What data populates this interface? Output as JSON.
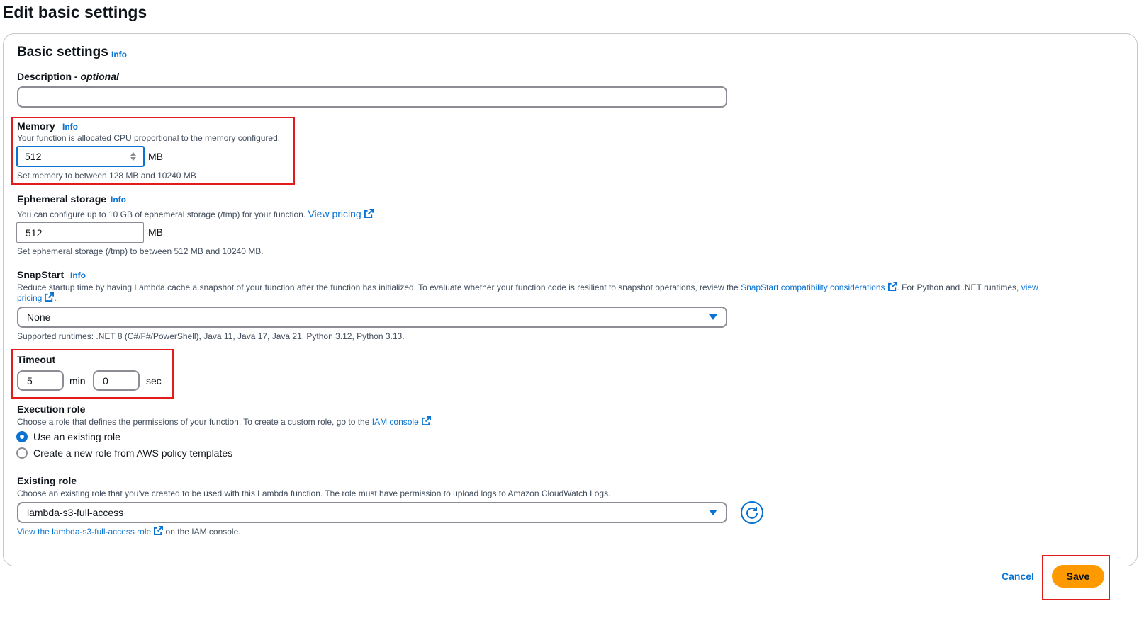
{
  "page": {
    "title": "Edit basic settings"
  },
  "section": {
    "title": "Basic settings",
    "info": "Info"
  },
  "description": {
    "label": "Description",
    "label_suffix": "optional",
    "value": ""
  },
  "memory": {
    "label": "Memory",
    "info": "Info",
    "desc": "Your function is allocated CPU proportional to the memory configured.",
    "value": "512",
    "unit": "MB",
    "hint": "Set memory to between 128 MB and 10240 MB"
  },
  "ephemeral": {
    "label": "Ephemeral storage",
    "info": "Info",
    "desc": "You can configure up to 10 GB of ephemeral storage (/tmp) for your function.",
    "link": "View pricing",
    "value": "512",
    "unit": "MB",
    "hint": "Set ephemeral storage (/tmp) to between 512 MB and 10240 MB."
  },
  "snapstart": {
    "label": "SnapStart",
    "info": "Info",
    "desc_1": "Reduce startup time by having Lambda cache a snapshot of your function after the function has initialized. To evaluate whether your function code is resilient to snapshot operations, review the",
    "link_1": "SnapStart compatibility considerations",
    "desc_2": ". For Python and .NET runtimes,",
    "link_2a": "view",
    "link_2b": "pricing",
    "desc_3": ".",
    "selected": "None",
    "hint": "Supported runtimes: .NET 8 (C#/F#/PowerShell), Java 11, Java 17, Java 21, Python 3.12, Python 3.13."
  },
  "timeout": {
    "label": "Timeout",
    "min_value": "5",
    "min_unit": "min",
    "sec_value": "0",
    "sec_unit": "sec"
  },
  "execution_role": {
    "label": "Execution role",
    "desc": "Choose a role that defines the permissions of your function. To create a custom role, go to the",
    "link": "IAM console",
    "desc_end": ".",
    "options": [
      "Use an existing role",
      "Create a new role from AWS policy templates"
    ],
    "selected_index": 0
  },
  "existing_role": {
    "label": "Existing role",
    "desc": "Choose an existing role that you've created to be used with this Lambda function. The role must have permission to upload logs to Amazon CloudWatch Logs.",
    "selected": "lambda-s3-full-access",
    "link": "View the lambda-s3-full-access role",
    "link_suffix": "on the IAM console."
  },
  "footer": {
    "cancel": "Cancel",
    "save": "Save"
  },
  "colors": {
    "accent": "#0972d3",
    "save": "#ff9900",
    "highlight": "#e31b1b"
  }
}
